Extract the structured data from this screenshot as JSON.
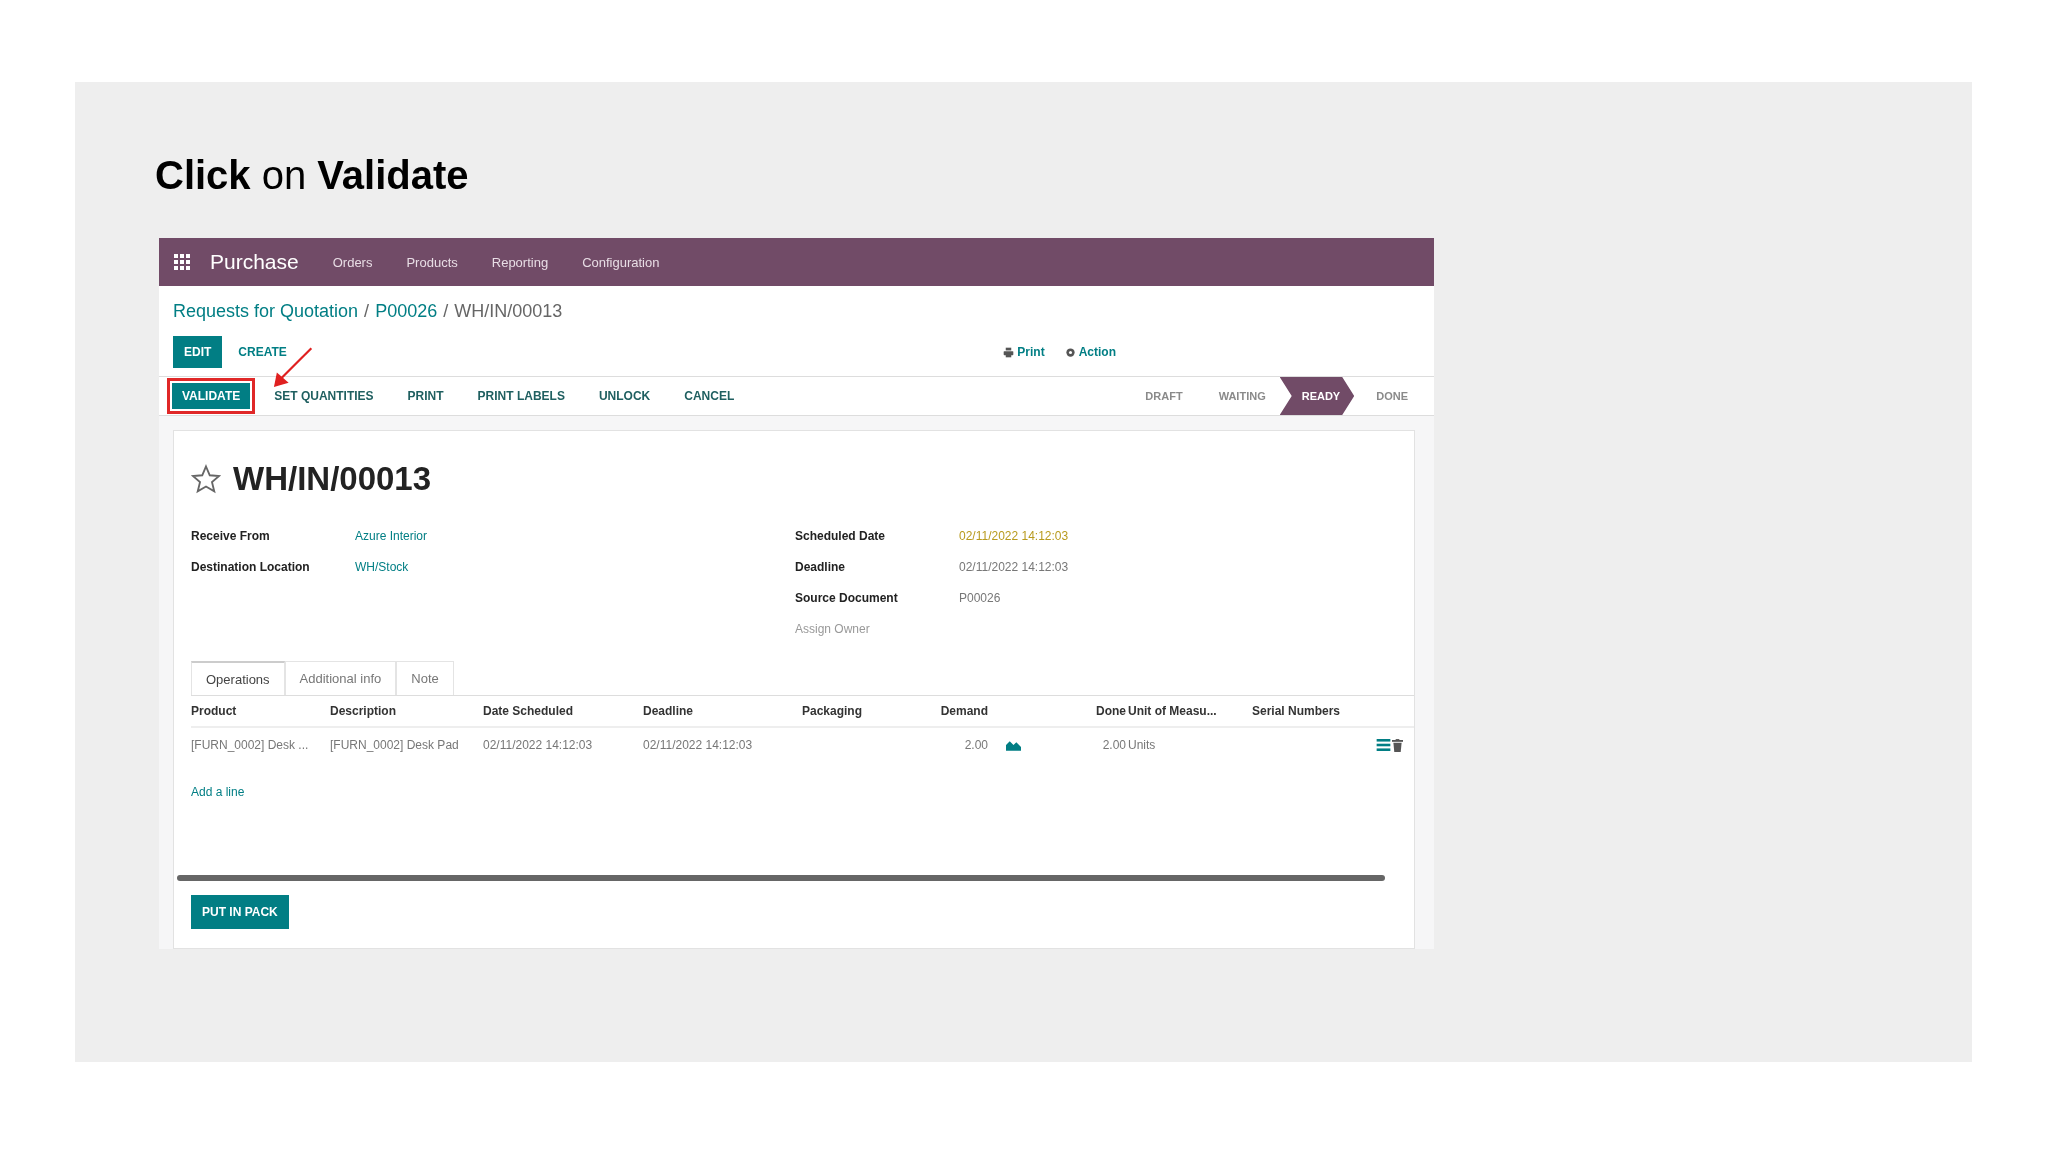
{
  "slide": {
    "heading": "**Click** on **Validate**"
  },
  "navbar": {
    "app_name": "Purchase",
    "menu": [
      "Orders",
      "Products",
      "Reporting",
      "Configuration"
    ]
  },
  "breadcrumb_separator": "/",
  "breadcrumb": [
    {
      "label": "Requests for Quotation",
      "kind": "link"
    },
    {
      "label": "P00026",
      "kind": "link"
    },
    {
      "label": "WH/IN/00013",
      "kind": "current"
    }
  ],
  "control_buttons": [
    {
      "label": "EDIT",
      "kind": "primary"
    },
    {
      "label": "CREATE",
      "kind": "plain"
    }
  ],
  "actions": [
    {
      "label": "Print",
      "kind": "print"
    },
    {
      "label": "Action",
      "kind": "gear"
    }
  ],
  "status_buttons": [
    {
      "label": "VALIDATE",
      "kind": "primary",
      "highlighted": true
    },
    {
      "label": "SET QUANTITIES",
      "kind": "plain",
      "highlighted": false
    },
    {
      "label": "PRINT",
      "kind": "plain",
      "highlighted": false
    },
    {
      "label": "PRINT LABELS",
      "kind": "plain",
      "highlighted": false
    },
    {
      "label": "UNLOCK",
      "kind": "plain",
      "highlighted": false
    },
    {
      "label": "CANCEL",
      "kind": "plain",
      "highlighted": false
    }
  ],
  "stages": [
    {
      "label": "DRAFT",
      "selected": false
    },
    {
      "label": "WAITING",
      "selected": false
    },
    {
      "label": "READY",
      "selected": true
    },
    {
      "label": "DONE",
      "selected": false
    }
  ],
  "record": {
    "title": "WH/IN/00013",
    "starred": false
  },
  "fields_left": [
    {
      "label": "Receive From",
      "value": "Azure Interior",
      "kind": "link"
    },
    {
      "label": "Destination Location",
      "value": "WH/Stock",
      "kind": "link"
    }
  ],
  "fields_right": [
    {
      "label": "Scheduled Date",
      "value": "02/11/2022 14:12:03",
      "kind": "warning"
    },
    {
      "label": "Deadline",
      "value": "02/11/2022 14:12:03",
      "kind": "plain"
    },
    {
      "label": "Source Document",
      "value": "P00026",
      "kind": "plain"
    },
    {
      "label": "Assign Owner",
      "kind": "empty"
    }
  ],
  "tabs": [
    {
      "label": "Operations",
      "selected": true
    },
    {
      "label": "Additional info",
      "selected": false
    },
    {
      "label": "Note",
      "selected": false
    }
  ],
  "table": {
    "columns": [
      "Product",
      "Description",
      "Date Scheduled",
      "Deadline",
      "Packaging",
      "Demand",
      "Done",
      "Unit of Measu...",
      "Serial Numbers"
    ],
    "rows": [
      {
        "product": "[FURN_0002] Desk ...",
        "description": "[FURN_0002] Desk Pad",
        "date_scheduled": "02/11/2022 14:12:03",
        "deadline": "02/11/2022 14:12:03",
        "demand": "2.00",
        "done": "2.00",
        "unit": "Units"
      }
    ],
    "add_line": "Add a line"
  },
  "footer_button": "PUT IN PACK"
}
